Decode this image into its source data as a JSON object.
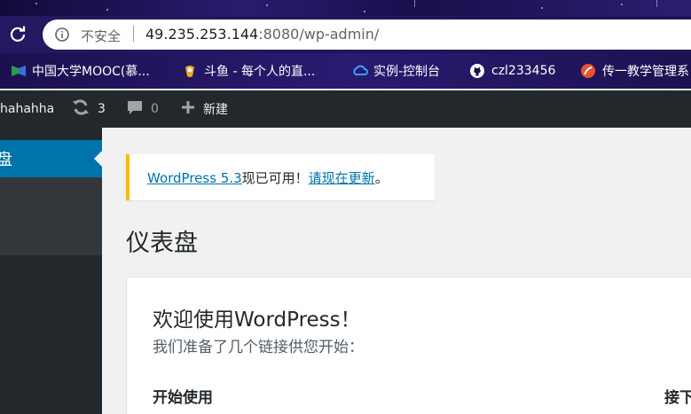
{
  "browser": {
    "security_label": "不安全",
    "url_host": "49.235.253.144",
    "url_rest": ":8080/wp-admin/",
    "bookmarks": [
      {
        "label": "中国大学MOOC(慕...",
        "icon": "mooc-icon"
      },
      {
        "label": "斗鱼 - 每个人的直...",
        "icon": "douyu-icon"
      },
      {
        "label": "实例-控制台",
        "icon": "cloud-icon"
      },
      {
        "label": "czl233456",
        "icon": "github-icon"
      },
      {
        "label": "传一教学管理系",
        "icon": "chuanyi-icon"
      }
    ]
  },
  "adminbar": {
    "site_name": "hahahha",
    "updates_count": "3",
    "comments_count": "0",
    "new_label": "新建"
  },
  "sidebar": {
    "current_item": "盘"
  },
  "notice": {
    "link1": "WordPress 5.3",
    "text1": "现已可用！",
    "link2": "请现在更新",
    "text2": "。"
  },
  "main": {
    "page_title": "仪表盘",
    "welcome_title": "欢迎使用WordPress！",
    "welcome_sub": "我们准备了几个链接供您开始：",
    "col1_heading": "开始使用",
    "col2_heading": "接下"
  },
  "colors": {
    "wp_blue": "#0073aa",
    "adminbar_bg": "#23282d",
    "notice_accent": "#ffb900"
  }
}
